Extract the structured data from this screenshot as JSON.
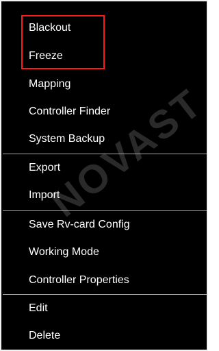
{
  "watermark": "NOVAST",
  "menu": {
    "items": [
      {
        "label": "Blackout"
      },
      {
        "label": "Freeze"
      },
      {
        "label": "Mapping"
      },
      {
        "label": "Controller Finder"
      },
      {
        "label": "System Backup"
      },
      {
        "label": "Export"
      },
      {
        "label": "Import"
      },
      {
        "label": "Save Rv-card Config"
      },
      {
        "label": "Working Mode"
      },
      {
        "label": "Controller Properties"
      },
      {
        "label": "Edit"
      },
      {
        "label": "Delete"
      }
    ],
    "highlight_color": "#ff1a1a"
  }
}
